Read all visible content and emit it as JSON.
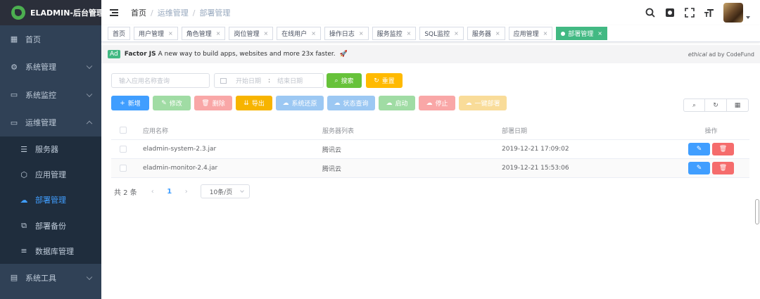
{
  "app": {
    "title": "ELADMIN-后台管理"
  },
  "sidebar": {
    "items": [
      {
        "label": "首页",
        "icon": "dashboard-icon"
      },
      {
        "label": "系统管理",
        "icon": "gear-icon"
      },
      {
        "label": "系统监控",
        "icon": "monitor-icon"
      },
      {
        "label": "运维管理",
        "icon": "ops-icon"
      }
    ],
    "submenu": [
      {
        "label": "服务器",
        "icon": "server-icon"
      },
      {
        "label": "应用管理",
        "icon": "app-icon"
      },
      {
        "label": "部署管理",
        "icon": "cloud-upload-icon",
        "active": true
      },
      {
        "label": "部署备份",
        "icon": "backup-icon"
      },
      {
        "label": "数据库管理",
        "icon": "database-icon"
      }
    ],
    "tail": [
      {
        "label": "系统工具",
        "icon": "toolbox-icon"
      }
    ]
  },
  "navbar": {
    "breadcrumb": [
      "首页",
      "运维管理",
      "部署管理"
    ],
    "icons": [
      "search-icon",
      "github-icon",
      "fullscreen-icon",
      "font-size-icon"
    ]
  },
  "tags": [
    "首页",
    "用户管理",
    "角色管理",
    "岗位管理",
    "在线用户",
    "操作日志",
    "服务监控",
    "SQL监控",
    "服务器",
    "应用管理"
  ],
  "active_tag": "部署管理",
  "ad": {
    "badge": "Ad",
    "brand": "Factor JS",
    "text": "A new way to build apps, websites and more 23x faster.",
    "credit_italic": "ethical",
    "credit_rest": "ad by CodeFund"
  },
  "search": {
    "placeholder": "输入应用名称查询",
    "date_start": "开始日期",
    "date_sep": ":",
    "date_end": "结束日期",
    "search_label": "搜索",
    "reset_label": "重置"
  },
  "toolbar": {
    "buttons": [
      {
        "label": "新增",
        "icon": "+",
        "color": "#409eff"
      },
      {
        "label": "修改",
        "icon": "✎",
        "color": "#a0dca4"
      },
      {
        "label": "删除",
        "icon": "🗑",
        "color": "#f9a7a7"
      },
      {
        "label": "导出",
        "icon": "⇊",
        "color": "#f7b400"
      },
      {
        "label": "系统还原",
        "icon": "☁",
        "color": "#9cc8f3"
      },
      {
        "label": "状态查询",
        "icon": "☁",
        "color": "#9cc8f3"
      },
      {
        "label": "启动",
        "icon": "☁",
        "color": "#a0dca4"
      },
      {
        "label": "停止",
        "icon": "☁",
        "color": "#f9a7a7"
      },
      {
        "label": "一键部署",
        "icon": "☁",
        "color": "#f9dc99"
      }
    ]
  },
  "colors": {
    "primary": "#409eff",
    "success": "#67c23a",
    "warning": "#ffba00",
    "danger": "#f56c6c",
    "sidebar_bg": "#304156",
    "tag_active": "#42b983"
  },
  "table": {
    "headers": [
      "应用名称",
      "服务器列表",
      "部署日期",
      "操作"
    ],
    "rows": [
      {
        "name": "eladmin-system-2.3.jar",
        "server": "腾讯云",
        "date": "2019-12-21 17:09:02"
      },
      {
        "name": "eladmin-monitor-2.4.jar",
        "server": "腾讯云",
        "date": "2019-12-21 15:53:06"
      }
    ]
  },
  "pagination": {
    "total": "共 2 条",
    "current": "1",
    "page_size": "10条/页"
  }
}
